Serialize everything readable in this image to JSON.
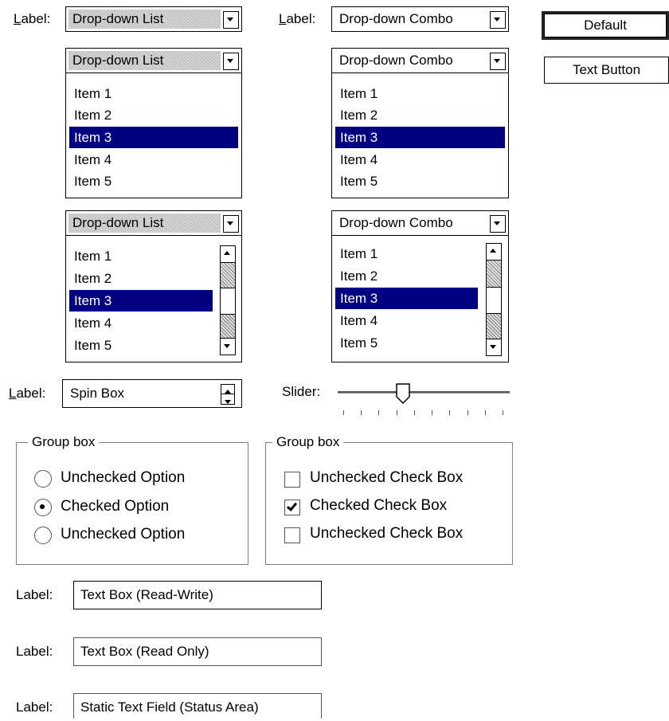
{
  "top_row": {
    "list_label": "Label:",
    "list_value": "Drop-down List",
    "combo_label": "Label:",
    "combo_value": "Drop-down Combo"
  },
  "buttons": {
    "default_label": "Default",
    "text_label": "Text Button"
  },
  "list_expanded": {
    "value": "Drop-down List",
    "items": [
      "Item 1",
      "Item 2",
      "Item 3",
      "Item 4",
      "Item 5"
    ],
    "selected": "Item 3"
  },
  "combo_expanded": {
    "value": "Drop-down Combo",
    "items": [
      "Item 1",
      "Item 2",
      "Item 3",
      "Item 4",
      "Item 5"
    ],
    "selected": "Item 3"
  },
  "list_scroll": {
    "value": "Drop-down List",
    "items": [
      "Item 1",
      "Item 2",
      "Item 3",
      "Item 4",
      "Item 5"
    ],
    "selected": "Item 3"
  },
  "combo_scroll": {
    "value": "Drop-down Combo",
    "items": [
      "Item 1",
      "Item 2",
      "Item 3",
      "Item 4",
      "Item 5"
    ],
    "selected": "Item 3"
  },
  "spin": {
    "label": "Label:",
    "value": "Spin Box"
  },
  "slider": {
    "label": "Slider:",
    "tick_count": 10,
    "position": 0.33
  },
  "radio_group": {
    "title": "Group box",
    "options": [
      {
        "label": "Unchecked Option",
        "checked": false
      },
      {
        "label": "Checked Option",
        "checked": true
      },
      {
        "label": "Unchecked Option",
        "checked": false
      }
    ]
  },
  "check_group": {
    "title": "Group box",
    "options": [
      {
        "label": "Unchecked Check Box",
        "checked": false
      },
      {
        "label": "Checked Check Box",
        "checked": true
      },
      {
        "label": "Unchecked Check Box",
        "checked": false
      }
    ]
  },
  "textboxes": [
    {
      "label": "Label:",
      "value": "Text Box (Read-Write)"
    },
    {
      "label": "Label:",
      "value": "Text Box (Read Only)"
    },
    {
      "label": "Label:",
      "value": "Static Text Field (Status Area)"
    }
  ],
  "colors": {
    "selection": "#000080",
    "hatch": "#bcbcbc"
  },
  "icons": [
    "chevron-down-icon",
    "chevron-up-icon",
    "radio-icon",
    "checkbox-icon",
    "slider-thumb-icon"
  ]
}
